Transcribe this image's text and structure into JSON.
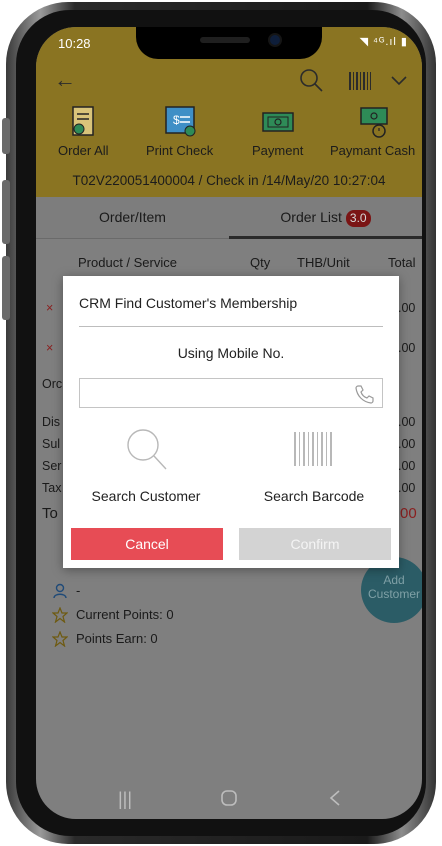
{
  "status": {
    "time": "10:28",
    "icons": "◥ ⁴ᴳ.ıl ▮"
  },
  "action_buttons": [
    {
      "label": "Order All",
      "icon": "order-all-icon"
    },
    {
      "label": "Print Check",
      "icon": "print-check-icon"
    },
    {
      "label": "Payment",
      "icon": "payment-icon"
    },
    {
      "label": "Paymant Cash",
      "icon": "payment-cash-icon"
    }
  ],
  "checkin_text": "T02V220051400004 / Check in /14/May/20 10:27:04",
  "tabs": {
    "order_item": "Order/Item",
    "order_list": "Order List",
    "order_list_badge": "3.0"
  },
  "table_header": {
    "product": "Product / Service",
    "qty": "Qty",
    "unit": "THB/Unit",
    "total": "Total"
  },
  "background_rows": {
    "x1": "×",
    "v1": ".00",
    "x2": "×",
    "v2": ".00",
    "ord": "Orc",
    "dis": "Dis",
    "sub": "Sul",
    "ser": "Ser",
    "tax": "Tax",
    "tot": "To",
    "r1": ".00",
    "r2": ".00",
    "r3": ".00",
    "r4": ".00",
    "r5": "00"
  },
  "customer": {
    "name": "-",
    "current_points": "Current Points: 0",
    "points_earn": "Points Earn: 0"
  },
  "add_customer": {
    "line1": "Add",
    "line2": "Customer"
  },
  "modal": {
    "title": "CRM Find Customer's Membership",
    "subtitle": "Using Mobile No.",
    "input_value": "",
    "search_customer": "Search Customer",
    "search_barcode": "Search Barcode",
    "cancel": "Cancel",
    "confirm": "Confirm"
  },
  "colors": {
    "appbar": "#8a7422",
    "cancel": "#e74c55",
    "confirm_disabled": "#d3d3d3",
    "badge": "#7a1414"
  }
}
